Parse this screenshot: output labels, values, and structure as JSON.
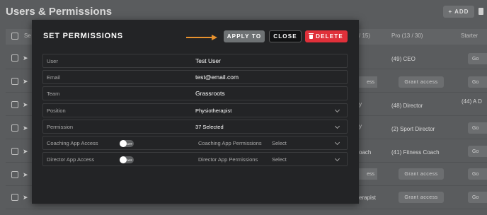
{
  "background": {
    "title": "Users & Permissions",
    "add_button": "+ ADD",
    "header_cells": [
      "Se",
      "/ 15)",
      "Pro  (13 / 30)",
      "Starter"
    ],
    "rows": [
      {
        "col_a": "",
        "col_b": "(49)  CEO",
        "grant": "",
        "tail": "Go"
      },
      {
        "col_a": "ess",
        "col_b": "",
        "grant": "Grant access",
        "tail": "Go"
      },
      {
        "col_a": "y",
        "col_b": "(48)  Director",
        "grant": "",
        "tail": "(44)  A\nD"
      },
      {
        "col_a": "y",
        "col_b": "(2)  Sport Director",
        "grant": "",
        "tail": "Go"
      },
      {
        "col_a": "oach",
        "col_b": "(41)  Fitness Coach",
        "grant": "",
        "tail": "Go"
      },
      {
        "col_a": "ess",
        "col_b": "",
        "grant": "Grant access",
        "tail": "Go"
      },
      {
        "col_a": "erapist",
        "col_b": "",
        "grant": "Grant access",
        "tail": "Go"
      }
    ]
  },
  "modal": {
    "title": "SET PERMISSIONS",
    "apply_label": "APPLY TO",
    "close_label": "CLOSE",
    "delete_label": "DELETE",
    "arrow_color": "#e8922e",
    "delete_color": "#e0303a",
    "fields": {
      "user": {
        "label": "User",
        "value": "Test User"
      },
      "email": {
        "label": "Email",
        "value": "test@email.com"
      },
      "team": {
        "label": "Team",
        "value": "Grassroots"
      },
      "position": {
        "label": "Position",
        "value": "Physiotherapist"
      },
      "permission": {
        "label": "Permission",
        "value": "37 Selected"
      },
      "coaching": {
        "label": "Coaching App Access",
        "toggle": "OFF",
        "sub_label": "Coaching App Permissions",
        "sub_value": "Select"
      },
      "director": {
        "label": "Director App Access",
        "toggle": "OFF",
        "sub_label": "Director App Permissions",
        "sub_value": "Select"
      }
    }
  }
}
